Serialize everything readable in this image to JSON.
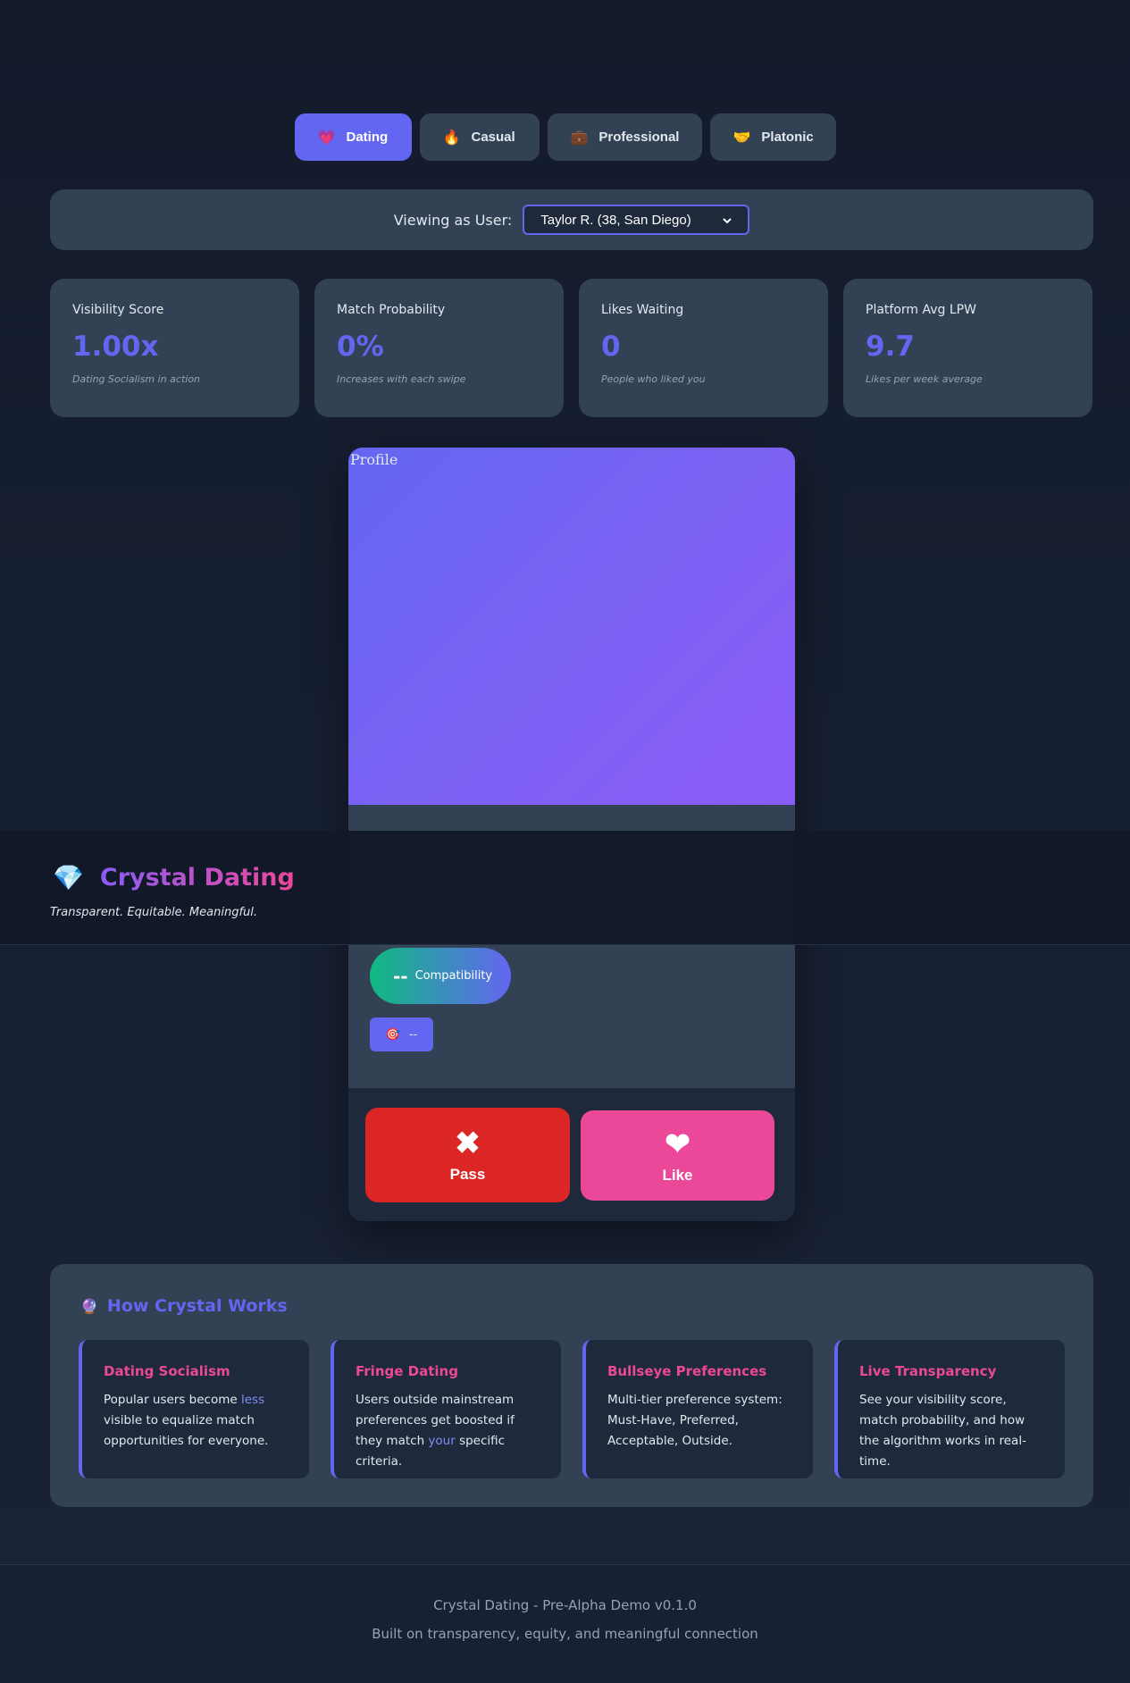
{
  "tabs": [
    {
      "icon": "💗",
      "label": "Dating"
    },
    {
      "icon": "🔥",
      "label": "Casual"
    },
    {
      "icon": "💼",
      "label": "Professional"
    },
    {
      "icon": "🤝",
      "label": "Platonic"
    }
  ],
  "user_bar": {
    "label": "Viewing as User:",
    "selected": "Taylor R. (38, San Diego)"
  },
  "stats": [
    {
      "title": "Visibility Score",
      "value": "1.00x",
      "desc": "Dating Socialism in action"
    },
    {
      "title": "Match Probability",
      "value": "0%",
      "desc": "Increases with each swipe"
    },
    {
      "title": "Likes Waiting",
      "value": "0",
      "desc": "People who liked you"
    },
    {
      "title": "Platform Avg LPW",
      "value": "9.7",
      "desc": "Likes per week average"
    }
  ],
  "card": {
    "photo_alt": "Profile",
    "compat_value": "--",
    "compat_label": "Compatibility",
    "target_icon": "🎯",
    "target_value": "--",
    "pass_glyph": "✖",
    "pass_label": "Pass",
    "like_glyph": "❤",
    "like_label": "Like"
  },
  "header": {
    "gem": "💎",
    "brand": "Crystal Dating",
    "tagline": "Transparent. Equitable. Meaningful."
  },
  "how": {
    "icon": "🔮",
    "title": "How Crystal Works",
    "features": [
      {
        "title": "Dating Socialism",
        "pre": "Popular users become ",
        "hl": "less",
        "post": " visible to equalize match opportunities for everyone."
      },
      {
        "title": "Fringe Dating",
        "pre": "Users outside mainstream preferences get boosted if they match ",
        "hl": "your",
        "post": " specific criteria."
      },
      {
        "title": "Bullseye Preferences",
        "pre": "Multi-tier preference system: Must-Have, Preferred, Acceptable, Outside.",
        "hl": "",
        "post": ""
      },
      {
        "title": "Live Transparency",
        "pre": "See your visibility score, match probability, and how the algorithm works in real-time.",
        "hl": "",
        "post": ""
      }
    ]
  },
  "footer": {
    "line1": "Crystal Dating - Pre-Alpha Demo v0.1.0",
    "line2": "Built on transparency, equity, and meaningful connection"
  },
  "colors": {
    "accent": "#6366f1",
    "pink": "#ec4899",
    "pass_red": "#dc2626",
    "panel": "#334155",
    "background": "#131a2c"
  }
}
